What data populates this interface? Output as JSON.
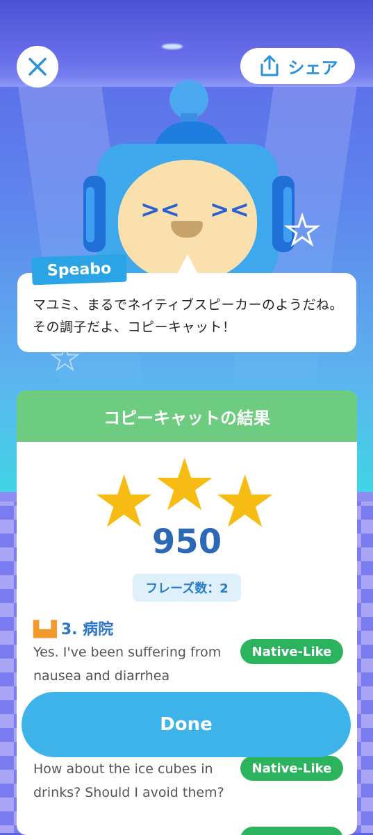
{
  "header": {
    "share_label": "シェア"
  },
  "speech": {
    "speaker": "Speabo",
    "message": "マユミ、まるでネイティブスピーカーのようだね。その調子だよ、コピーキャット！"
  },
  "result": {
    "title": "コピーキャットの結果",
    "stars_earned": 3,
    "stars_total": 3,
    "score": "950",
    "phrase_count_label": "フレーズ数：2",
    "section_title": "3. 病院",
    "phrases": [
      {
        "text": "Yes. I've been suffering from nausea and diarrhea",
        "rating": "Native-Like"
      },
      {
        "text": "How about the ice cubes in drinks? Should I avoid them?",
        "rating": "Native-Like"
      }
    ]
  },
  "actions": {
    "done_label": "Done"
  },
  "colors": {
    "accent_blue": "#3db3ea",
    "header_green": "#6dcc80",
    "badge_green": "#2cb35e",
    "star_gold": "#f7bc14"
  },
  "icons": [
    "close-icon",
    "share-icon",
    "hospital-icon",
    "star-icon"
  ]
}
